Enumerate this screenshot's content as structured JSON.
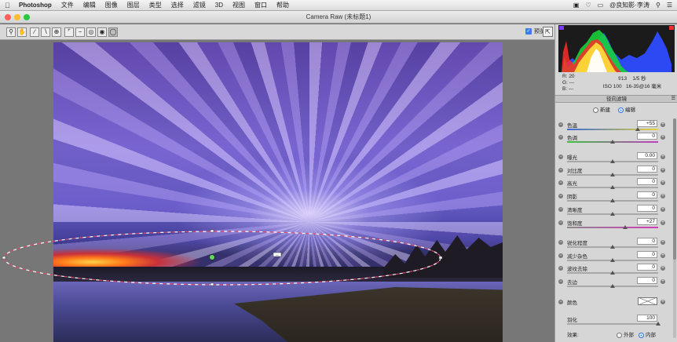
{
  "menubar": {
    "app": "Photoshop",
    "items": [
      "文件",
      "编辑",
      "图像",
      "图层",
      "类型",
      "选择",
      "滤镜",
      "3D",
      "视图",
      "窗口",
      "帮助"
    ],
    "user": "@良知影·李涛"
  },
  "window": {
    "title": "Camera Raw (未标题1)"
  },
  "toolbar": {
    "tools": [
      "zoom-icon",
      "hand-icon",
      "white-balance-icon",
      "color-sampler-icon",
      "target-adjust-icon",
      "crop-icon",
      "straighten-icon",
      "spot-removal-icon",
      "red-eye-icon",
      "adjustment-brush-icon",
      "graduated-filter-icon",
      "radial-filter-icon"
    ],
    "preview_label": "预览",
    "preview_checked": true
  },
  "readout": {
    "r_label": "R:",
    "r_value": "20",
    "g_label": "G:",
    "g_value": "---",
    "b_label": "B:",
    "b_value": "---",
    "aperture": "f/13",
    "shutter": "1/5 秒",
    "iso": "ISO 100",
    "lens": "16-35@16 毫米"
  },
  "panel": {
    "title": "径向滤镜",
    "mode_new": "新建",
    "mode_edit": "编辑",
    "mode_selected": "edit",
    "sliders": [
      {
        "label": "色温",
        "value": "+55",
        "level": 0.78,
        "track": "temp"
      },
      {
        "label": "色调",
        "value": "0",
        "level": 0.5,
        "track": "tint"
      },
      {
        "label": "曝光",
        "value": "0.00",
        "level": 0.5,
        "track": "plain"
      },
      {
        "label": "对比度",
        "value": "0",
        "level": 0.5,
        "track": "plain"
      },
      {
        "label": "高光",
        "value": "0",
        "level": 0.5,
        "track": "plain"
      },
      {
        "label": "阴影",
        "value": "0",
        "level": 0.5,
        "track": "plain"
      },
      {
        "label": "清晰度",
        "value": "0",
        "level": 0.5,
        "track": "plain"
      },
      {
        "label": "饱和度",
        "value": "+27",
        "level": 0.64,
        "track": "sat"
      },
      {
        "label": "锐化程度",
        "value": "0",
        "level": 0.5,
        "track": "plain"
      },
      {
        "label": "减少杂色",
        "value": "0",
        "level": 0.5,
        "track": "plain"
      },
      {
        "label": "波纹去除",
        "value": "0",
        "level": 0.5,
        "track": "plain"
      },
      {
        "label": "去边",
        "value": "0",
        "level": 0.5,
        "track": "plain"
      }
    ],
    "color_label": "颜色",
    "feather_label": "羽化",
    "feather_value": "100",
    "feather_level": 1.0,
    "effect_label": "效果:",
    "effect_outside": "外部",
    "effect_inside": "内部",
    "effect_selected": "inside"
  },
  "colors": {
    "accent": "#2f72df",
    "overlay_dash": "#ffffff",
    "overlay_dash_alt": "#e0486a",
    "pin": "#5fd45f"
  }
}
